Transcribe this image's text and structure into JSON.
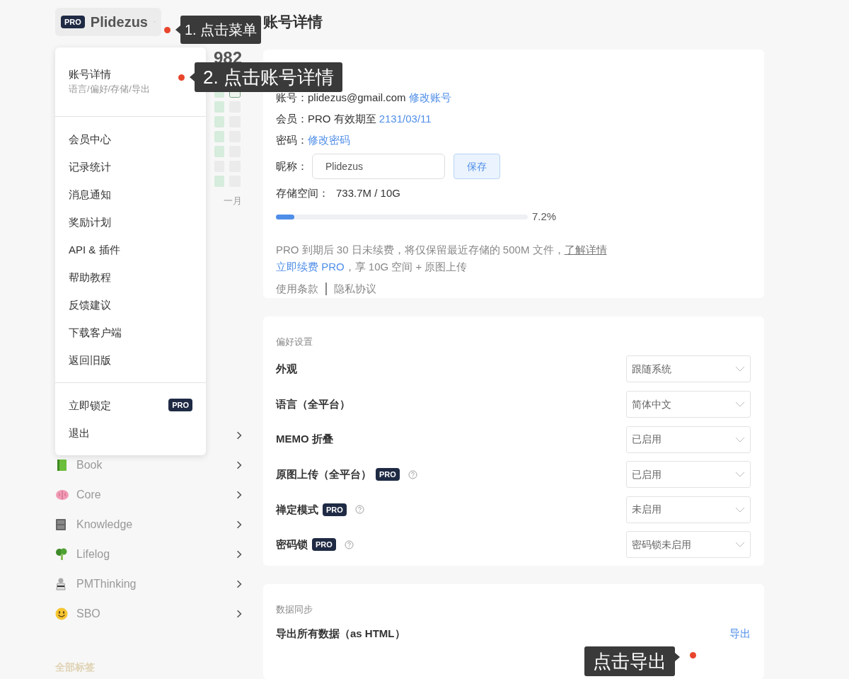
{
  "header": {
    "badge": "PRO",
    "name": "Plidezus"
  },
  "sidebar": {
    "count": "982",
    "month": "一月",
    "tags": [
      {
        "kind": "covered"
      },
      {
        "kind": "tag",
        "label": "Book"
      },
      {
        "kind": "tag",
        "label": "Core"
      },
      {
        "kind": "tag",
        "label": "Knowledge"
      },
      {
        "kind": "tag",
        "label": "Lifelog"
      },
      {
        "kind": "tag",
        "label": "PMThinking"
      },
      {
        "kind": "tag",
        "label": "SBO"
      }
    ],
    "all_tags": "全部标签"
  },
  "menu": {
    "sections": [
      [
        {
          "label": "账号详情",
          "subtitle": "语言/偏好/存储/导出"
        }
      ],
      [
        {
          "label": "会员中心"
        },
        {
          "label": "记录统计"
        },
        {
          "label": "消息通知"
        },
        {
          "label": "奖励计划"
        },
        {
          "label": "API & 插件"
        },
        {
          "label": "帮助教程"
        },
        {
          "label": "反馈建议"
        },
        {
          "label": "下载客户端"
        },
        {
          "label": "返回旧版"
        }
      ],
      [
        {
          "label": "立即锁定",
          "badge": "PRO"
        },
        {
          "label": "退出"
        }
      ]
    ]
  },
  "account": {
    "title": "账号详情",
    "rows": [
      {
        "label": "账号：",
        "value": "plidezus@gmail.com",
        "link": "修改账号"
      },
      {
        "label": "会员：",
        "value": "PRO 有效期至",
        "link": "2131/03/11"
      },
      {
        "label": "密码：",
        "link": "修改密码"
      }
    ],
    "nickname": {
      "label": "昵称：",
      "value": "Plidezus",
      "button": "保存"
    },
    "storage": {
      "label": "存储空间：",
      "value": "733.7M / 10G",
      "level": 0.072,
      "percent": "7.2%"
    },
    "notice": {
      "text": "PRO 到期后 30 日未续费，将仅保留最近存储的 500M 文件，",
      "link": "了解详情"
    },
    "renew": {
      "link": "立即续费 PRO",
      "text": "，享 10G 空间 + 原图上传"
    },
    "footer_links": [
      "使用条款",
      "隐私协议"
    ]
  },
  "preferences": {
    "title": "偏好设置",
    "rows": [
      {
        "label": "外观",
        "value": "跟随系统"
      },
      {
        "label": "语言（全平台）",
        "value": "简体中文"
      },
      {
        "label": "MEMO 折叠",
        "value": "已启用"
      },
      {
        "label": "原图上传（全平台）",
        "badge": "PRO",
        "help": true,
        "value": "已启用"
      },
      {
        "label": "禅定模式",
        "badge": "PRO",
        "help": true,
        "value": "未启用"
      },
      {
        "label": "密码锁",
        "badge": "PRO",
        "help": true,
        "value": "密码锁未启用"
      }
    ]
  },
  "data_sync": {
    "title": "数据同步",
    "rows": [
      {
        "label": "导出所有数据（as HTML）",
        "action": "导出"
      }
    ]
  },
  "annotations": [
    {
      "text": "1. 点击菜单"
    },
    {
      "text": "2. 点击账号详情"
    },
    {
      "text": "点击导出"
    }
  ]
}
